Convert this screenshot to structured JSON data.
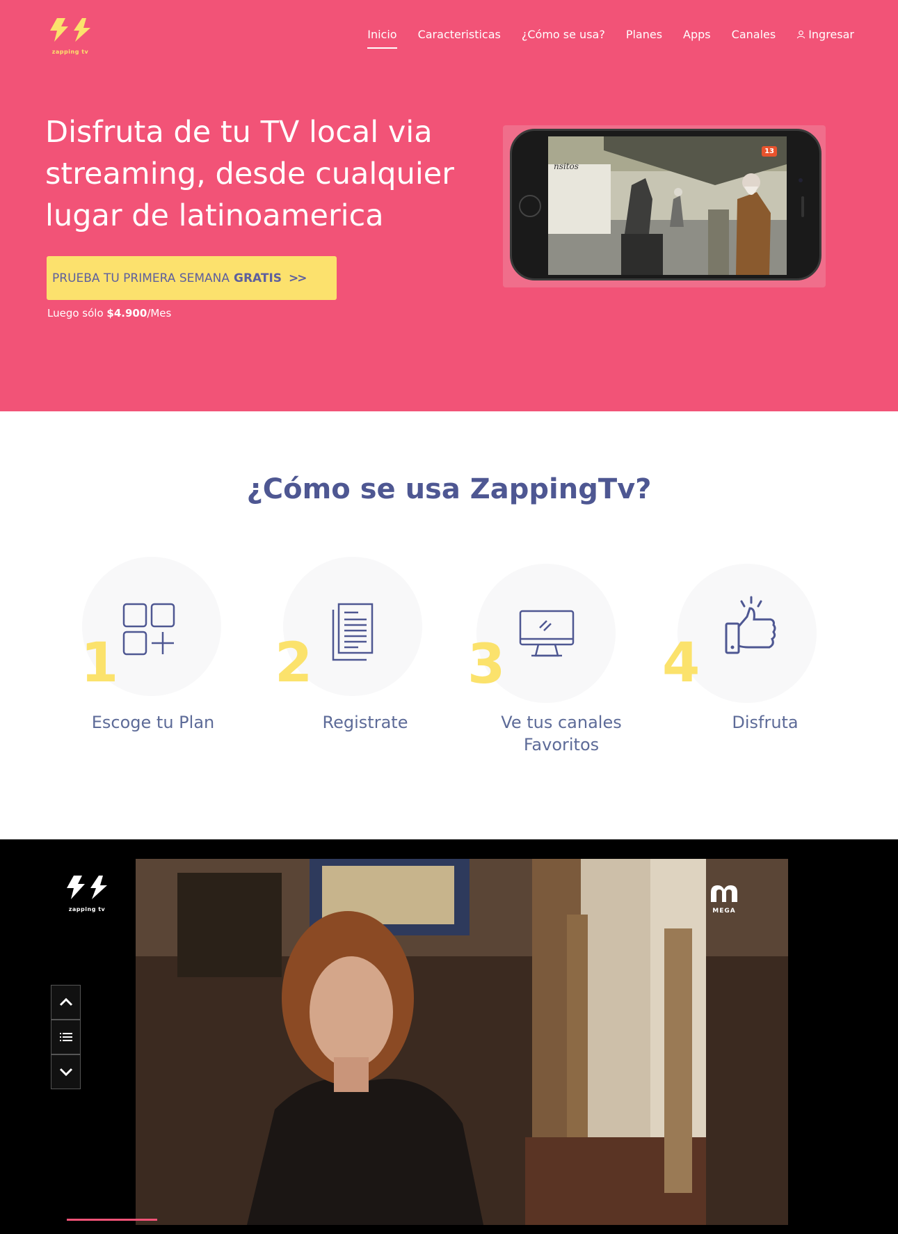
{
  "brand": {
    "name": "zapping tv",
    "colors": {
      "primary": "#f25377",
      "accent": "#fce16d",
      "heading": "#4e5792"
    }
  },
  "nav": {
    "items": [
      {
        "label": "Inicio",
        "active": true
      },
      {
        "label": "Caracteristicas"
      },
      {
        "label": "¿Cómo se usa?"
      },
      {
        "label": "Planes"
      },
      {
        "label": "Apps"
      },
      {
        "label": "Canales"
      }
    ],
    "login": {
      "label": "Ingresar",
      "icon": "user-icon"
    }
  },
  "hero": {
    "title": "Disfruta de tu TV local via streaming, desde cualquier lugar de latinoamerica",
    "cta": {
      "label": "PRUEBA TU PRIMERA SEMANA",
      "emphasis": "GRATIS",
      "icon": "double-chevron-right-icon"
    },
    "price_prefix": "Luego sólo",
    "price_value": "$4.900",
    "price_suffix": "/Mes",
    "phone_screen": {
      "sign": "nsitos",
      "badge": "13"
    }
  },
  "howto": {
    "title": "¿Cómo se usa ZappingTv?",
    "steps": [
      {
        "number": "1",
        "label": "Escoge tu Plan",
        "icon": "grid-plus-icon"
      },
      {
        "number": "2",
        "label": "Registrate",
        "icon": "document-icon"
      },
      {
        "number": "3",
        "label": "Ve tus canales Favoritos",
        "icon": "monitor-icon"
      },
      {
        "number": "4",
        "label": "Disfruta",
        "icon": "thumbs-up-icon"
      }
    ]
  },
  "player": {
    "channel": "MEGA",
    "controls": [
      "chevron-up-icon",
      "list-icon",
      "chevron-down-icon"
    ]
  }
}
